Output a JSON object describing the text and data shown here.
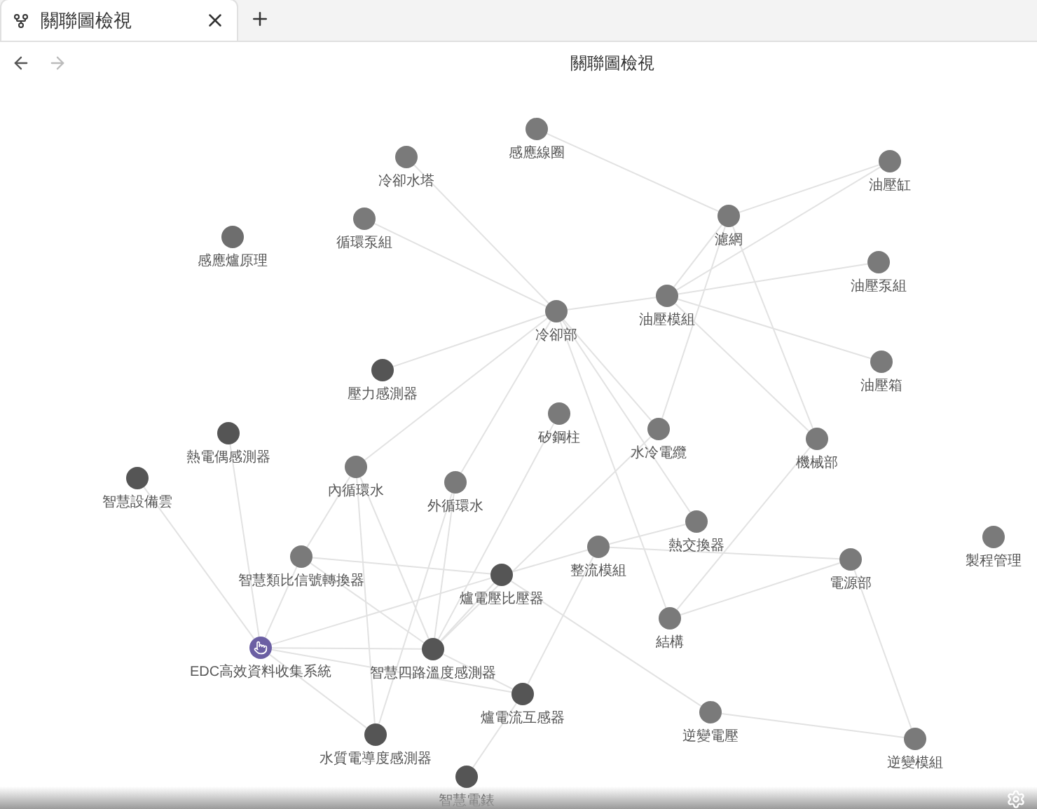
{
  "tabs": [
    {
      "title": "關聯圖檢視",
      "selected": true
    }
  ],
  "view": {
    "title": "關聯圖檢視"
  },
  "graph": {
    "nodes": [
      {
        "label": "冷卻水塔",
        "color": "#7a7a7a"
      },
      {
        "label": "感應線圈",
        "color": "#7a7a7a"
      },
      {
        "label": "油壓缸",
        "color": "#7a7a7a"
      },
      {
        "label": "循環泵組",
        "color": "#7a7a7a"
      },
      {
        "label": "感應爐原理",
        "color": "#6e6e6e"
      },
      {
        "label": "濾網",
        "color": "#7a7a7a"
      },
      {
        "label": "油壓泵組",
        "color": "#7a7a7a"
      },
      {
        "label": "油壓模組",
        "color": "#7a7a7a"
      },
      {
        "label": "冷卻部",
        "color": "#7a7a7a"
      },
      {
        "label": "油壓箱",
        "color": "#7a7a7a"
      },
      {
        "label": "壓力感測器",
        "color": "#555555"
      },
      {
        "label": "矽鋼柱",
        "color": "#7a7a7a"
      },
      {
        "label": "水冷電纜",
        "color": "#7a7a7a"
      },
      {
        "label": "機械部",
        "color": "#7a7a7a"
      },
      {
        "label": "熱電偶感測器",
        "color": "#555555"
      },
      {
        "label": "智慧設備雲",
        "color": "#555555"
      },
      {
        "label": "內循環水",
        "color": "#7a7a7a"
      },
      {
        "label": "外循環水",
        "color": "#7a7a7a"
      },
      {
        "label": "熱交換器",
        "color": "#7a7a7a"
      },
      {
        "label": "整流模組",
        "color": "#7a7a7a"
      },
      {
        "label": "電源部",
        "color": "#7a7a7a"
      },
      {
        "label": "製程管理",
        "color": "#7a7a7a"
      },
      {
        "label": "智慧類比信號轉換器",
        "color": "#7a7a7a"
      },
      {
        "label": "爐電壓比壓器",
        "color": "#555555"
      },
      {
        "label": "結構",
        "color": "#7a7a7a"
      },
      {
        "label": "EDC高效資料收集系統",
        "color": "#6b5fa3"
      },
      {
        "label": "智慧四路溫度感測器",
        "color": "#555555"
      },
      {
        "label": "爐電流互感器",
        "color": "#555555"
      },
      {
        "label": "逆變電壓",
        "color": "#7a7a7a"
      },
      {
        "label": "逆變模組",
        "color": "#7a7a7a"
      },
      {
        "label": "水質電導度感測器",
        "color": "#555555"
      },
      {
        "label": "智慧電錶",
        "color": "#555555"
      }
    ]
  }
}
